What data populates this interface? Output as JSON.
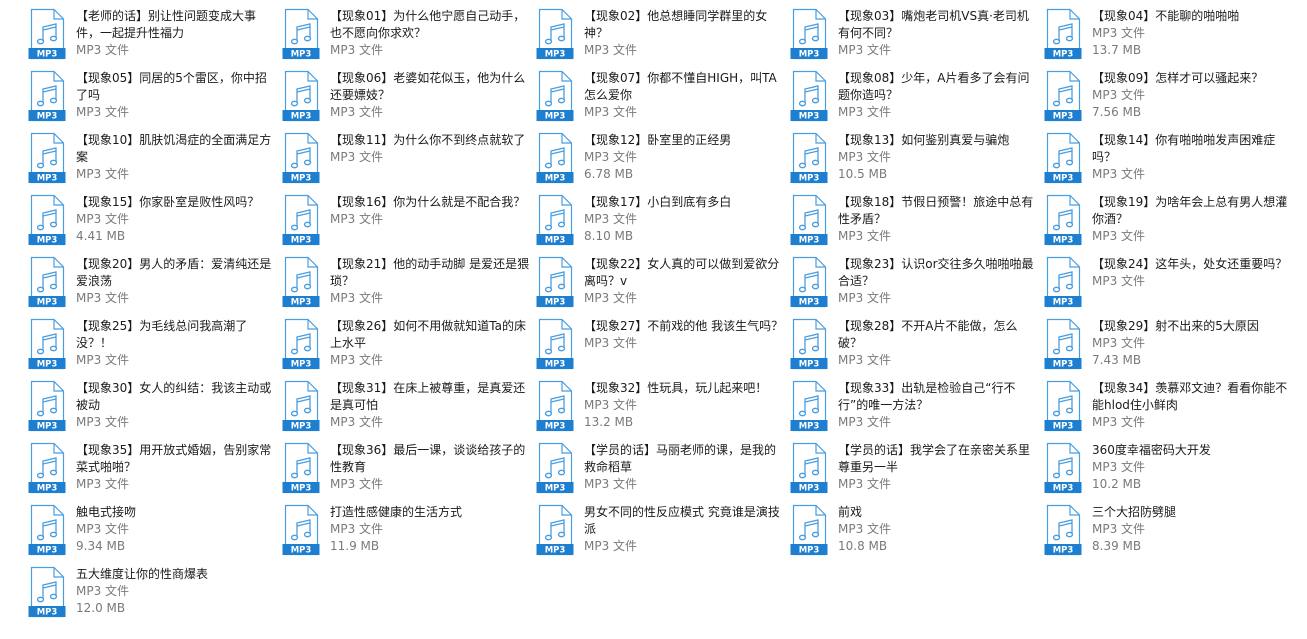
{
  "icon": {
    "name": "mp3-file-icon",
    "badge_label": "MP3",
    "accent_color": "#1e7fd1",
    "outline_color": "#4a9ee0"
  },
  "files": [
    {
      "name": "【老师的话】别让性问题变成大事件，一起提升性福力",
      "type": "MP3 文件",
      "size": ""
    },
    {
      "name": "【现象01】为什么他宁愿自己动手，也不愿向你求欢？",
      "type": "MP3 文件",
      "size": ""
    },
    {
      "name": "【现象02】他总想睡同学群里的女神？",
      "type": "MP3 文件",
      "size": ""
    },
    {
      "name": "【现象03】嘴炮老司机VS真·老司机有何不同？",
      "type": "MP3 文件",
      "size": ""
    },
    {
      "name": "【现象04】不能聊的啪啪啪",
      "type": "MP3 文件",
      "size": "13.7 MB"
    },
    {
      "name": "【现象05】同居的5个雷区，你中招了吗",
      "type": "MP3 文件",
      "size": ""
    },
    {
      "name": "【现象06】老婆如花似玉，他为什么还要嫖妓？",
      "type": "MP3 文件",
      "size": ""
    },
    {
      "name": "【现象07】你都不懂自HIGH，叫TA怎么爱你",
      "type": "MP3 文件",
      "size": ""
    },
    {
      "name": "【现象08】少年，A片看多了会有问题你造吗？",
      "type": "MP3 文件",
      "size": ""
    },
    {
      "name": "【现象09】怎样才可以骚起来？",
      "type": "MP3 文件",
      "size": "7.56 MB"
    },
    {
      "name": "【现象10】肌肤饥渴症的全面满足方案",
      "type": "MP3 文件",
      "size": ""
    },
    {
      "name": "【现象11】为什么你不到终点就软了",
      "type": "MP3 文件",
      "size": ""
    },
    {
      "name": "【现象12】卧室里的正经男",
      "type": "MP3 文件",
      "size": "6.78 MB"
    },
    {
      "name": "【现象13】如何鉴别真爱与骗炮",
      "type": "MP3 文件",
      "size": "10.5 MB"
    },
    {
      "name": "【现象14】你有啪啪啪发声困难症吗？",
      "type": "MP3 文件",
      "size": ""
    },
    {
      "name": "【现象15】你家卧室是败性风吗？",
      "type": "MP3 文件",
      "size": "4.41 MB"
    },
    {
      "name": "【现象16】你为什么就是不配合我？",
      "type": "MP3 文件",
      "size": ""
    },
    {
      "name": "【现象17】小白到底有多白",
      "type": "MP3 文件",
      "size": "8.10 MB"
    },
    {
      "name": "【现象18】节假日预警！旅途中总有性矛盾？",
      "type": "MP3 文件",
      "size": ""
    },
    {
      "name": "【现象19】为啥年会上总有男人想灌你酒？",
      "type": "MP3 文件",
      "size": ""
    },
    {
      "name": "【现象20】男人的矛盾：爱清纯还是爱浪荡",
      "type": "MP3 文件",
      "size": ""
    },
    {
      "name": "【现象21】他的动手动脚 是爱还是猥琐？",
      "type": "MP3 文件",
      "size": ""
    },
    {
      "name": "【现象22】女人真的可以做到爱欲分离吗？v",
      "type": "MP3 文件",
      "size": ""
    },
    {
      "name": "【现象23】认识or交往多久啪啪啪最合适？",
      "type": "MP3 文件",
      "size": ""
    },
    {
      "name": "【现象24】这年头，处女还重要吗？",
      "type": "MP3 文件",
      "size": ""
    },
    {
      "name": "【现象25】为毛线总问我高潮了没？！",
      "type": "MP3 文件",
      "size": ""
    },
    {
      "name": "【现象26】如何不用做就知道Ta的床上水平",
      "type": "MP3 文件",
      "size": ""
    },
    {
      "name": "【现象27】不前戏的他 我该生气吗？",
      "type": "MP3 文件",
      "size": ""
    },
    {
      "name": "【现象28】不开A片不能做，怎么破？",
      "type": "MP3 文件",
      "size": ""
    },
    {
      "name": "【现象29】射不出来的5大原因",
      "type": "MP3 文件",
      "size": "7.43 MB"
    },
    {
      "name": "【现象30】女人的纠结：我该主动或被动",
      "type": "MP3 文件",
      "size": ""
    },
    {
      "name": "【现象31】在床上被尊重，是真爱还是真可怕",
      "type": "MP3 文件",
      "size": ""
    },
    {
      "name": "【现象32】性玩具，玩儿起来吧！",
      "type": "MP3 文件",
      "size": "13.2 MB"
    },
    {
      "name": "【现象33】出轨是检验自己“行不行”的唯一方法？",
      "type": "MP3 文件",
      "size": ""
    },
    {
      "name": "【现象34】羡慕邓文迪？看看你能不能hlod住小鲜肉",
      "type": "MP3 文件",
      "size": ""
    },
    {
      "name": "【现象35】用开放式婚姻，告别家常菜式啪啪？",
      "type": "MP3 文件",
      "size": ""
    },
    {
      "name": "【现象36】最后一课，谈谈给孩子的性教育",
      "type": "MP3 文件",
      "size": ""
    },
    {
      "name": "【学员的话】马丽老师的课，是我的救命稻草",
      "type": "MP3 文件",
      "size": ""
    },
    {
      "name": "【学员的话】我学会了在亲密关系里尊重另一半",
      "type": "MP3 文件",
      "size": ""
    },
    {
      "name": "360度幸福密码大开发",
      "type": "MP3 文件",
      "size": "10.2 MB"
    },
    {
      "name": "触电式接吻",
      "type": "MP3 文件",
      "size": "9.34 MB"
    },
    {
      "name": "打造性感健康的生活方式",
      "type": "MP3 文件",
      "size": "11.9 MB"
    },
    {
      "name": "男女不同的性反应模式 究竟谁是演技派",
      "type": "MP3 文件",
      "size": ""
    },
    {
      "name": "前戏",
      "type": "MP3 文件",
      "size": "10.8 MB"
    },
    {
      "name": "三个大招防劈腿",
      "type": "MP3 文件",
      "size": "8.39 MB"
    },
    {
      "name": "五大维度让你的性商爆表",
      "type": "MP3 文件",
      "size": "12.0 MB"
    }
  ]
}
